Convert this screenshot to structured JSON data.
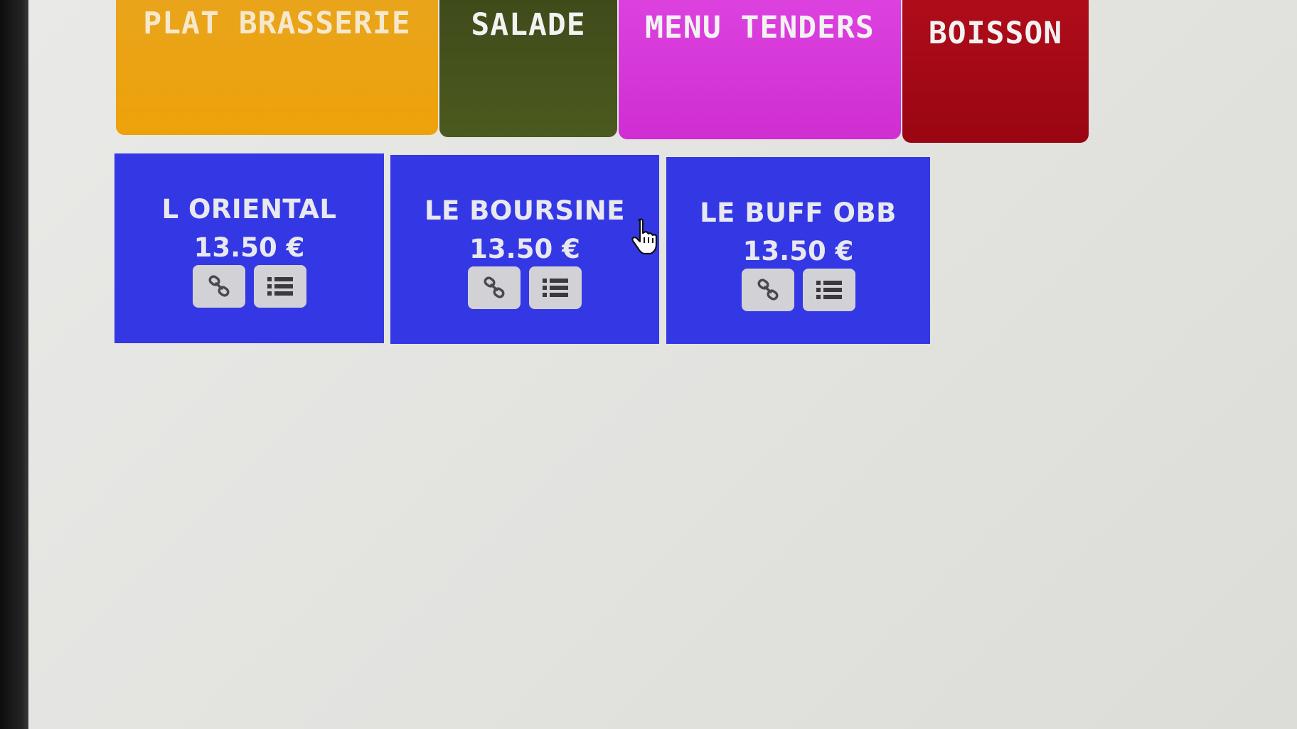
{
  "categories": [
    {
      "label": "PLAT BRASSERIE",
      "color": "#eea20a"
    },
    {
      "label": "SALADE",
      "color": "#4b5a1f"
    },
    {
      "label": "MENU TENDERS",
      "color": "#d63ad8"
    },
    {
      "label": "BOISSON",
      "color": "#a00814"
    }
  ],
  "products": [
    {
      "name": "L ORIENTAL",
      "price": "13.50 €"
    },
    {
      "name": "LE BOURSINE",
      "price": "13.50 €"
    },
    {
      "name": "LE BUFF OBB",
      "price": "13.50 €"
    }
  ],
  "colors": {
    "product_bg": "#3438e4",
    "button_bg": "#d2d2d6",
    "screen_bg": "#e4e4e1"
  },
  "icons": {
    "link": "link-icon",
    "list": "list-icon",
    "cursor": "hand-pointer-icon"
  }
}
